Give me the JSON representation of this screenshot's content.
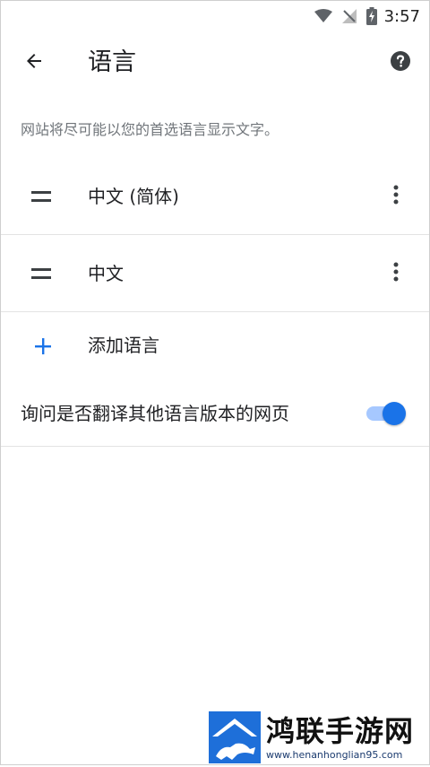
{
  "status_bar": {
    "time": "3:57",
    "icons": [
      "wifi-icon",
      "no-signal-icon",
      "battery-charging-icon"
    ]
  },
  "app_bar": {
    "title": "语言",
    "back_icon": "arrow-back-icon",
    "help_icon": "help-circle-icon"
  },
  "description": "网站将尽可能以您的首选语言显示文字。",
  "languages": [
    {
      "label": "中文 (简体)"
    },
    {
      "label": "中文"
    }
  ],
  "add_language": {
    "label": "添加语言",
    "icon": "plus-icon"
  },
  "translate_toggle": {
    "label": "询问是否翻译其他语言版本的网页",
    "enabled": true
  },
  "colors": {
    "accent": "#1a73e8",
    "accent_track": "#a6c8ff",
    "secondary_text": "#70757a",
    "divider": "#e3e3e3"
  },
  "watermark": {
    "name": "鸿联手游网",
    "url": "www.henanhonglian95.com"
  }
}
